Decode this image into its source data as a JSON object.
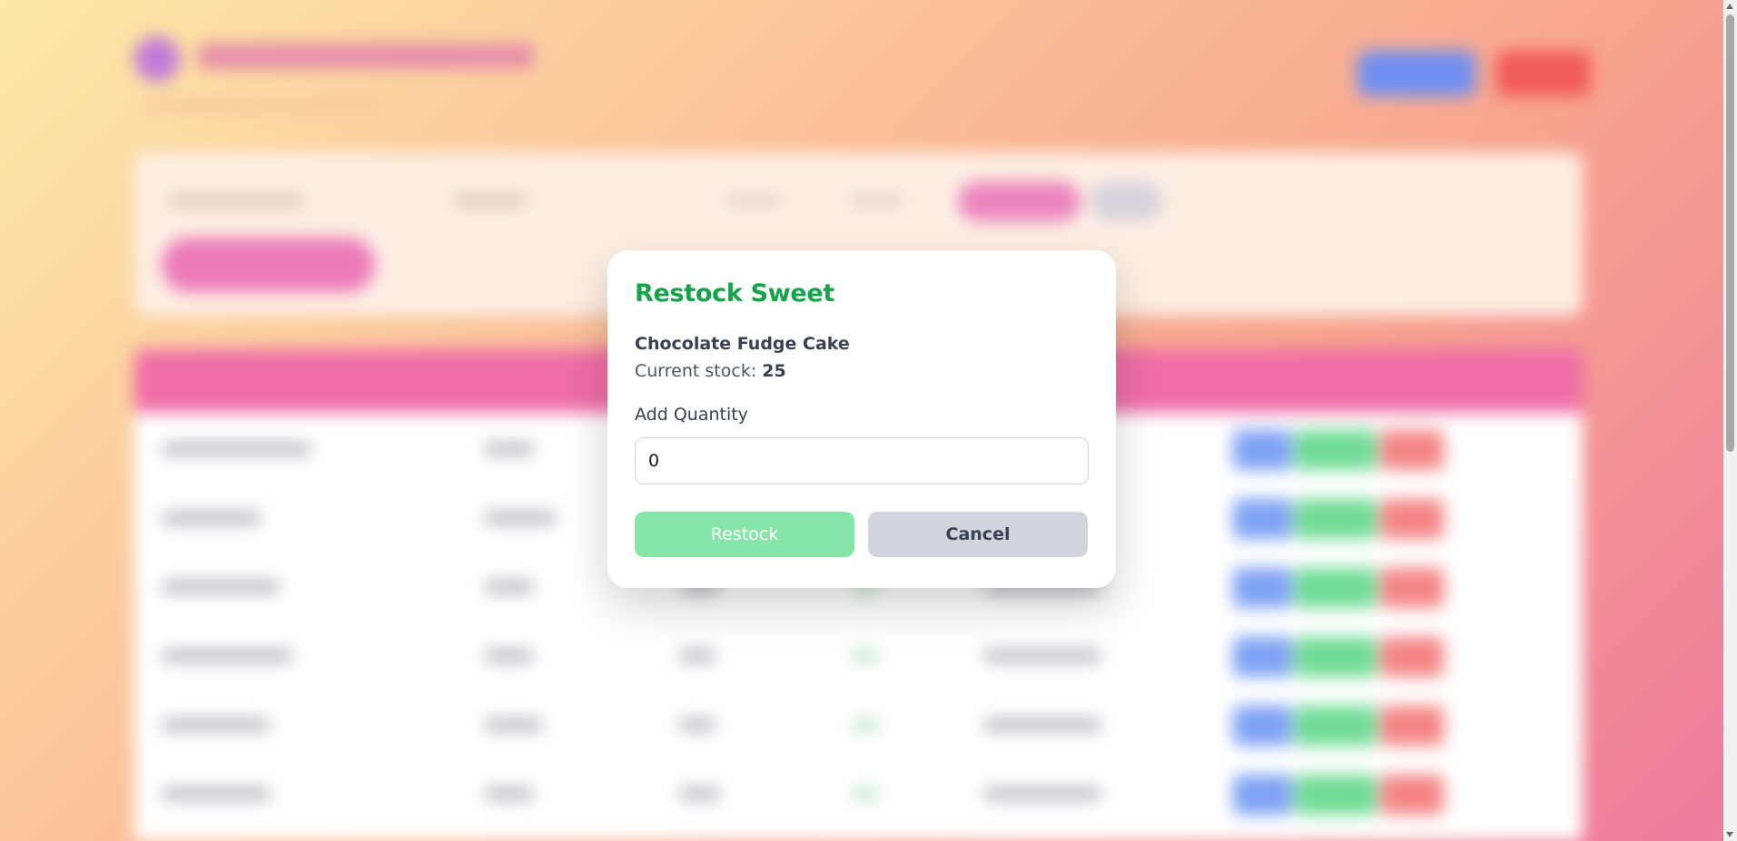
{
  "modal": {
    "title": "Restock Sweet",
    "item_name": "Chocolate Fudge Cake",
    "stock_label": "Current stock: ",
    "stock_value": "25",
    "quantity_label": "Add Quantity",
    "quantity_value": "0",
    "restock_button": "Restock",
    "cancel_button": "Cancel"
  },
  "colors": {
    "title_green": "#16a34a",
    "restock_button_disabled": "#86e5a8",
    "cancel_button": "#d1d5db",
    "table_header_pink": "#ef6ea7"
  }
}
